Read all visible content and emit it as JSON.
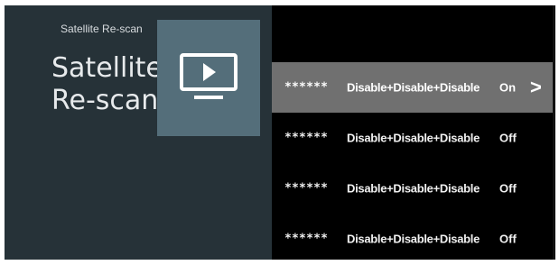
{
  "header": {
    "breadcrumb": "Satellite Re-scan",
    "title": "Satellite Re-scan"
  },
  "preview": {
    "icon": "tv-play-icon"
  },
  "list": {
    "rows": [
      {
        "id": "******",
        "label": "Disable+Disable+Disable",
        "state": "On",
        "chevron": ">"
      },
      {
        "id": "******",
        "label": "Disable+Disable+Disable",
        "state": "Off"
      },
      {
        "id": "******",
        "label": "Disable+Disable+Disable",
        "state": "Off"
      },
      {
        "id": "******",
        "label": "Disable+Disable+Disable",
        "state": "Off"
      }
    ]
  },
  "colors": {
    "left_panel": "#263238",
    "tile": "#546e7a",
    "selected_row": "#707070",
    "right_panel": "#000000"
  }
}
